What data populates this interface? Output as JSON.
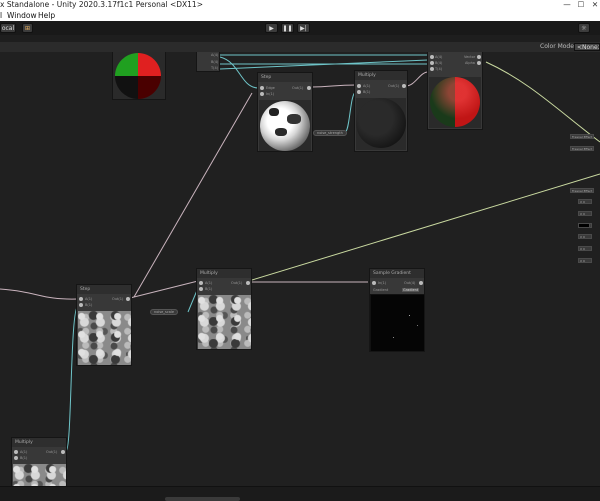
{
  "window": {
    "title": "x Standalone - Unity 2020.3.17f1c1 Personal <DX11>",
    "controls": [
      "—",
      "☐",
      "✕"
    ]
  },
  "menu": {
    "items": [
      "l",
      "Window",
      "Help"
    ]
  },
  "toolbar": {
    "local_label": "ocal",
    "play_icon": "play-icon",
    "pause_icon": "pause-icon",
    "step_icon": "step-icon",
    "play_glyph": "▶",
    "pause_glyph": "❚❚",
    "step_glyph": "▶|"
  },
  "shadergraph": {
    "color_mode_label": "Color Mode",
    "color_mode_value": "<None>"
  },
  "nodes": {
    "sample_top_left": {
      "header": ""
    },
    "texture_top": {
      "inputs": [
        "A(4)",
        "B(4)",
        "T(4)"
      ]
    },
    "mid_top": {
      "header": "Step",
      "inputs": [
        "Edge",
        "In(1)"
      ],
      "output": "Out(1)"
    },
    "multiply_top": {
      "header": "Multiply",
      "inputs": [
        "A(1)",
        "B(1)"
      ],
      "output": "Out(1)"
    },
    "combine_top": {
      "inputs": [
        "A(4)",
        "B(4)",
        "T(4)"
      ],
      "outputs": [
        "Vector",
        "Alpha"
      ]
    },
    "noise_left": {
      "header": "Step",
      "inputs": [
        "A(1)",
        "B(1)"
      ],
      "output": "Out(1)"
    },
    "multiply_mid": {
      "header": "Multiply",
      "inputs": [
        "A(1)",
        "B(1)"
      ],
      "output": "Out(1)"
    },
    "sample_right": {
      "header": "Sample Gradient",
      "inputs": [
        "In(1)"
      ],
      "output": "Out(4)",
      "row_label": "Gradient",
      "row_value": "Gradient"
    },
    "noise_bottom": {
      "header": "Multiply",
      "inputs": [
        "A(1)",
        "B(1)"
      ],
      "output": "Out(1)"
    }
  },
  "property_nodes": {
    "noise_strength": "noise_strength",
    "noise_scale": "noise_scale"
  },
  "right_panel": [
    "Fresnel Effect",
    "Fresnel Effect",
    "Fresnel Effect",
    "X 0",
    "X 0",
    "X 0",
    "X 0",
    "",
    "X 0",
    "X 0"
  ]
}
